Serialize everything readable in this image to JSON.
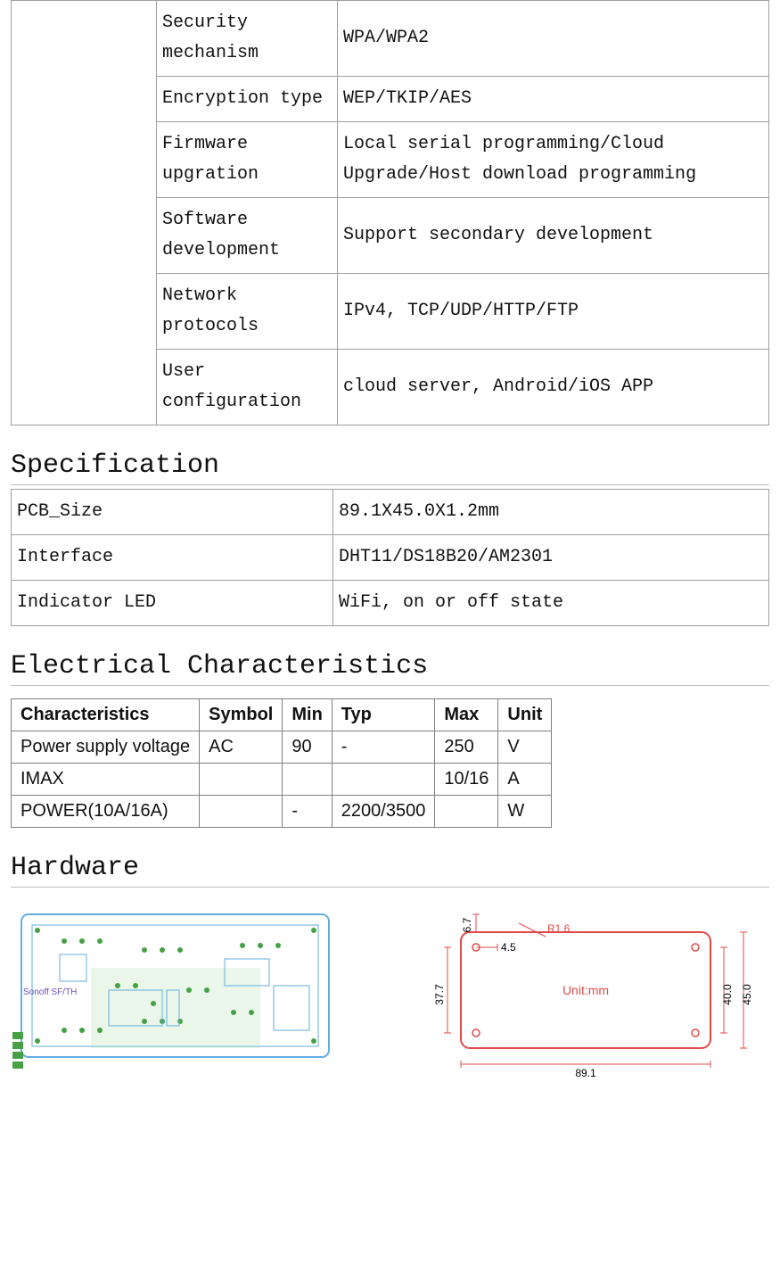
{
  "top_table": {
    "rows": [
      {
        "key": "Security mechanism",
        "value": "WPA/WPA2"
      },
      {
        "key": "Encryption type",
        "value": "WEP/TKIP/AES"
      },
      {
        "key": "Firmware upgration",
        "value": "Local serial programming/Cloud Upgrade/Host download programming"
      },
      {
        "key": "Software development",
        "value": "Support secondary development"
      },
      {
        "key": "Network protocols",
        "value": "IPv4, TCP/UDP/HTTP/FTP"
      },
      {
        "key": "User configuration",
        "value": "cloud server, Android/iOS APP"
      }
    ]
  },
  "sections": {
    "specification": "Specification",
    "electrical": "Electrical Characteristics",
    "hardware": "Hardware"
  },
  "spec_table": {
    "rows": [
      {
        "key": "PCB_Size",
        "value": "89.1X45.0X1.2mm"
      },
      {
        "key": "Interface",
        "value": "DHT11/DS18B20/AM2301"
      },
      {
        "key": "Indicator LED",
        "value": "WiFi, on or off state"
      }
    ]
  },
  "elec_table": {
    "headers": [
      "Characteristics",
      "Symbol",
      "Min",
      "Typ",
      "Max",
      "Unit"
    ],
    "rows": [
      [
        "Power supply voltage",
        "AC",
        "90",
        "-",
        "250",
        "V"
      ],
      [
        "IMAX",
        "",
        "",
        "",
        "10/16",
        "A"
      ],
      [
        "POWER(10A/16A)",
        "",
        "-",
        "2200/3500",
        "",
        "W"
      ]
    ]
  },
  "hardware_diagram": {
    "board_label": "Sonoff SF/TH",
    "unit_label": "Unit:mm",
    "radius_label": "R1.6",
    "dimensions": {
      "width": "89.1",
      "height_outer": "45.0",
      "height_inner": "40.0",
      "left_offset_v": "37.7",
      "top_offset_v": "6.7",
      "top_offset_h": "4.5"
    },
    "colors": {
      "board_outline": "#63aee0",
      "copper_fill": "#46a046",
      "silk_text": "#6a4fbf",
      "dim_line": "#e04a4a"
    }
  }
}
